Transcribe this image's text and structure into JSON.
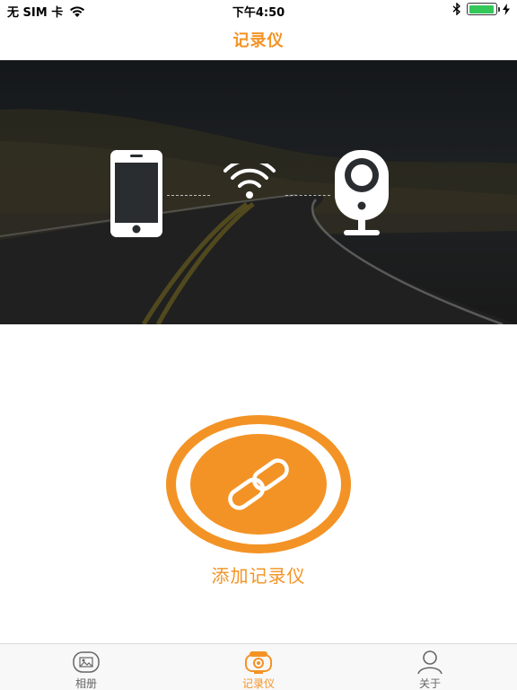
{
  "status_bar": {
    "carrier": "无 SIM 卡",
    "time": "下午4:50",
    "battery_level": 0.95,
    "battery_color": "#34c759"
  },
  "nav": {
    "title": "记录仪"
  },
  "banner": {
    "icons": [
      "phone-icon",
      "wifi-icon",
      "camera-icon"
    ]
  },
  "add_button": {
    "label": "添加记录仪",
    "icon": "link-icon"
  },
  "tabs": [
    {
      "label": "相册",
      "icon": "photo-icon",
      "active": false
    },
    {
      "label": "记录仪",
      "icon": "webcam-icon",
      "active": true
    },
    {
      "label": "关于",
      "icon": "person-icon",
      "active": false
    }
  ],
  "colors": {
    "accent": "#f39325",
    "accent_light": "#f5a347"
  }
}
